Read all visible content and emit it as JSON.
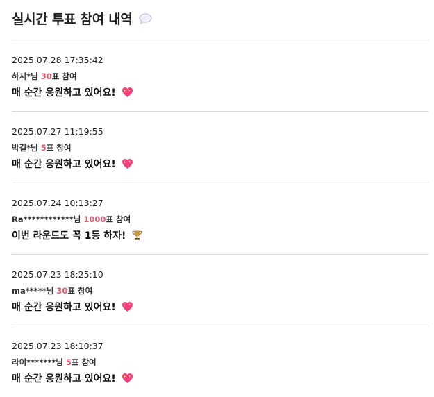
{
  "page": {
    "title": "실시간 투표 참여 내역",
    "title_icon": "speech-bubble-icon"
  },
  "colors": {
    "accent": "#e05a6d",
    "divider": "#d6d6d6",
    "text": "#111111"
  },
  "votes": [
    {
      "time": "2025.07.28 17:35:42",
      "user": "하시*님",
      "count": "30",
      "suffix": "표 참여",
      "message": "매 순간 응원하고 있어요!",
      "emoji": "sparkling-heart-icon"
    },
    {
      "time": "2025.07.27 11:19:55",
      "user": "박길*님",
      "count": "5",
      "suffix": "표 참여",
      "message": "매 순간 응원하고 있어요!",
      "emoji": "sparkling-heart-icon"
    },
    {
      "time": "2025.07.24 10:13:27",
      "user": "Ra************님",
      "count": "1000",
      "suffix": "표 참여",
      "message": "이번 라운드도 꼭 1등 하자!",
      "emoji": "trophy-icon"
    },
    {
      "time": "2025.07.23 18:25:10",
      "user": "ma*****님",
      "count": "30",
      "suffix": "표 참여",
      "message": "매 순간 응원하고 있어요!",
      "emoji": "sparkling-heart-icon"
    },
    {
      "time": "2025.07.23 18:10:37",
      "user": "라이*******님",
      "count": "5",
      "suffix": "표 참여",
      "message": "매 순간 응원하고 있어요!",
      "emoji": "sparkling-heart-icon"
    }
  ]
}
